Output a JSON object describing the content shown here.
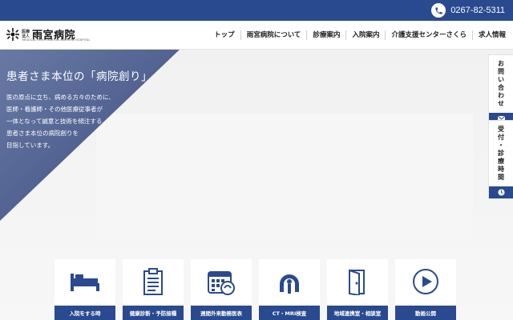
{
  "topbar": {
    "phone_number": "0267-82-5311",
    "phone_icon": "phone-icon"
  },
  "header": {
    "logo_small_1": "医療",
    "logo_small_2": "法人",
    "logo_name": "雨宮病院",
    "logo_sub": "MEDICAL CORPORATION AMEMIYA HOSPITAL",
    "nav": [
      {
        "label": "トップ"
      },
      {
        "label": "雨宮病院について"
      },
      {
        "label": "診療案内"
      },
      {
        "label": "入院案内"
      },
      {
        "label": "介護支援センターさくら"
      },
      {
        "label": "求人情報"
      }
    ]
  },
  "hero": {
    "title": "患者さま本位の「病院創り」",
    "lines": [
      "医の原点に立ち、病める方々のために、",
      "医師・看護師・その他医療従事者が",
      "一体となって誠意と技術を傾注する",
      "患者さま本位の病院創りを",
      "目指しています。"
    ]
  },
  "side_tabs": [
    {
      "label": "お問い合わせ",
      "icon": "mail-icon"
    },
    {
      "label": "受付・診療時間",
      "icon": "clock-icon"
    }
  ],
  "cards": [
    {
      "label": "入院をする時",
      "icon": "bed-icon"
    },
    {
      "label": "健康診断・予防接種",
      "icon": "clipboard-icon"
    },
    {
      "label": "週間外来勤務医表",
      "icon": "calendar-icon"
    },
    {
      "label": "CT・MRI検査",
      "icon": "mri-scanner-icon"
    },
    {
      "label": "地域連携室・相談室",
      "icon": "door-icon"
    },
    {
      "label": "動画公開",
      "icon": "play-icon"
    }
  ],
  "colors": {
    "brand": "#2a4a8f",
    "hero_gradient_start": "#5a6f9e",
    "hero_gradient_end": "#2e3f78"
  }
}
